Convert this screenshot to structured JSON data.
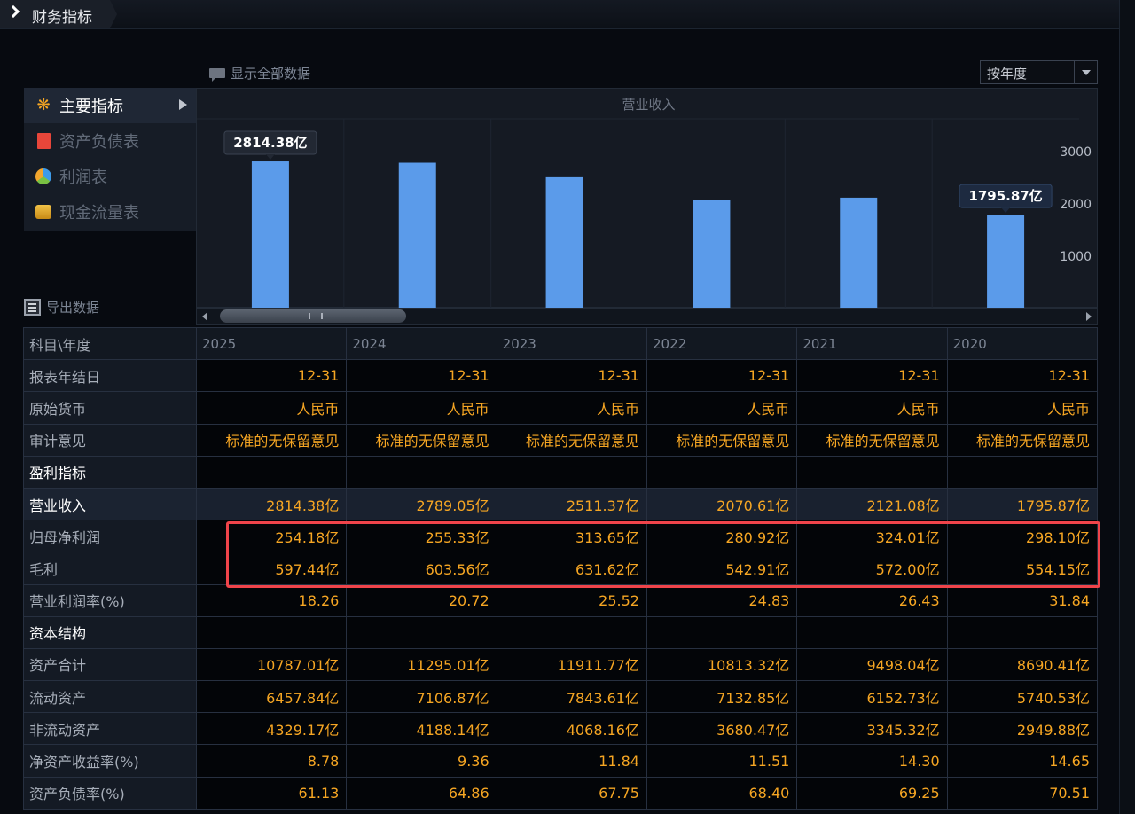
{
  "header": {
    "title": "财务指标"
  },
  "toolbar": {
    "show_all": "显示全部数据",
    "period_select": "按年度",
    "export": "导出数据"
  },
  "menu": {
    "items": [
      {
        "label": "主要指标",
        "icon": "asterisk-icon",
        "active": true
      },
      {
        "label": "资产负债表",
        "icon": "document-icon",
        "active": false
      },
      {
        "label": "利润表",
        "icon": "pie-icon",
        "active": false
      },
      {
        "label": "现金流量表",
        "icon": "coins-icon",
        "active": false
      }
    ]
  },
  "chart_data": {
    "type": "bar",
    "title": "营业收入",
    "categories": [
      "2025",
      "2024",
      "2023",
      "2022",
      "2021",
      "2020"
    ],
    "series": [
      {
        "values": [
          2814.38,
          2789.05,
          2511.37,
          2070.61,
          2121.08,
          1795.87
        ]
      }
    ],
    "y_ticks": [
      "1000",
      "2000",
      "3000"
    ],
    "ylim": [
      0,
      3900
    ],
    "data_labels": [
      {
        "category": "2025",
        "text": "2814.38亿"
      },
      {
        "category": "2020",
        "text": "1795.87亿"
      }
    ],
    "bar_color": "#5b9bea"
  },
  "table": {
    "header_label": "科目\\年度",
    "years": [
      "2025",
      "2024",
      "2023",
      "2022",
      "2021",
      "2020"
    ],
    "rows": [
      {
        "label": "报表年结日",
        "values": [
          "12-31",
          "12-31",
          "12-31",
          "12-31",
          "12-31",
          "12-31"
        ]
      },
      {
        "label": "原始货币",
        "values": [
          "人民币",
          "人民币",
          "人民币",
          "人民币",
          "人民币",
          "人民币"
        ]
      },
      {
        "label": "审计意见",
        "values": [
          "标准的无保留意见",
          "标准的无保留意见",
          "标准的无保留意见",
          "标准的无保留意见",
          "标准的无保留意见",
          "标准的无保留意见"
        ]
      },
      {
        "label": "盈利指标",
        "section": true,
        "values": [
          "",
          "",
          "",
          "",
          "",
          ""
        ]
      },
      {
        "label": "营业收入",
        "highlight": true,
        "values": [
          "2814.38亿",
          "2789.05亿",
          "2511.37亿",
          "2070.61亿",
          "2121.08亿",
          "1795.87亿"
        ]
      },
      {
        "label": "归母净利润",
        "values": [
          "254.18亿",
          "255.33亿",
          "313.65亿",
          "280.92亿",
          "324.01亿",
          "298.10亿"
        ]
      },
      {
        "label": "毛利",
        "values": [
          "597.44亿",
          "603.56亿",
          "631.62亿",
          "542.91亿",
          "572.00亿",
          "554.15亿"
        ]
      },
      {
        "label": "营业利润率(%)",
        "values": [
          "18.26",
          "20.72",
          "25.52",
          "24.83",
          "26.43",
          "31.84"
        ]
      },
      {
        "label": "资本结构",
        "section": true,
        "values": [
          "",
          "",
          "",
          "",
          "",
          ""
        ]
      },
      {
        "label": "资产合计",
        "values": [
          "10787.01亿",
          "11295.01亿",
          "11911.77亿",
          "10813.32亿",
          "9498.04亿",
          "8690.41亿"
        ]
      },
      {
        "label": "流动资产",
        "values": [
          "6457.84亿",
          "7106.87亿",
          "7843.61亿",
          "7132.85亿",
          "6152.73亿",
          "5740.53亿"
        ]
      },
      {
        "label": "非流动资产",
        "values": [
          "4329.17亿",
          "4188.14亿",
          "4068.16亿",
          "3680.47亿",
          "3345.32亿",
          "2949.88亿"
        ]
      },
      {
        "label": "净资产收益率(%)",
        "values": [
          "8.78",
          "9.36",
          "11.84",
          "11.51",
          "14.30",
          "14.65"
        ]
      },
      {
        "label": "资产负债率(%)",
        "values": [
          "61.13",
          "64.86",
          "67.75",
          "68.40",
          "69.25",
          "70.51"
        ]
      }
    ]
  }
}
